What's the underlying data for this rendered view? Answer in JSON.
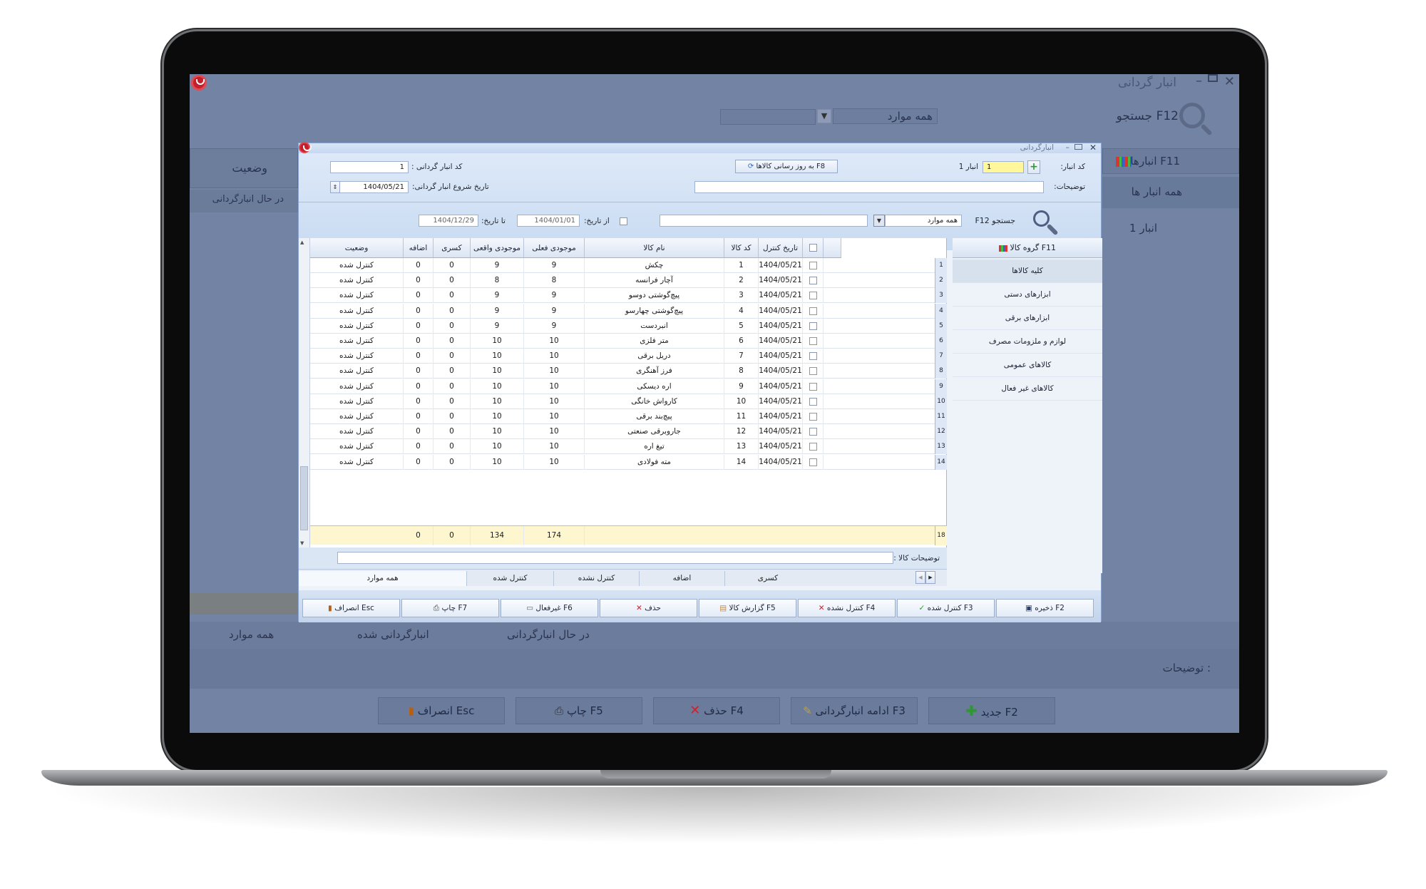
{
  "bg_window": {
    "title": "انبار گردانی",
    "minimize": "–",
    "close": "✕",
    "search_label": "جستجو F12",
    "search_scope": "همه موارد",
    "warehouses_header": "انبارها F11",
    "warehouses": [
      "همه انبار ها",
      "انبار 1"
    ],
    "status_header": "وضعیت",
    "status_value": "در حال انبارگردانی",
    "tabs": [
      "در حال انبارگردانی",
      "انبارگردانی شده",
      "همه موارد"
    ],
    "notes_label": "توضیحات :",
    "buttons": {
      "new": "جدید F2",
      "continue": "ادامه انبارگردانی F3",
      "delete": "حذف F4",
      "print": "چاپ F5",
      "cancel": "انصراف Esc"
    }
  },
  "dialog": {
    "title": "انبارگردانی",
    "warehouse_code_label": "کد انبار:",
    "warehouse_code_value": "1",
    "warehouse_name": "انبار 1",
    "notes_label": "توضیحات:",
    "update_button": "به روز رسانی کالاها F8",
    "count_code_label": "کد انبار گردانی :",
    "count_code_value": "1",
    "start_date_label": "تاریخ شروع انبار گردانی:",
    "start_date_value": "1404/05/21",
    "search_label": "جستجو F12",
    "search_scope": "همه موارد",
    "from_date_label": "از تاریخ:",
    "from_date_value": "1404/01/01",
    "to_date_label": "تا تاریخ:",
    "to_date_value": "1404/12/29",
    "columns": [
      "تاریخ کنترل",
      "کد کالا",
      "نام کالا",
      "موجودی فعلی",
      "موجودی واقعی",
      "کسری",
      "اضافه",
      "وضعیت"
    ],
    "rows": [
      {
        "idx": "1",
        "date": "1404/05/21",
        "code": "1",
        "name": "چکش",
        "current": "9",
        "actual": "9",
        "shortage": "0",
        "surplus": "0",
        "status": "کنترل شده"
      },
      {
        "idx": "2",
        "date": "1404/05/21",
        "code": "2",
        "name": "آچار فرانسه",
        "current": "8",
        "actual": "8",
        "shortage": "0",
        "surplus": "0",
        "status": "کنترل شده"
      },
      {
        "idx": "3",
        "date": "1404/05/21",
        "code": "3",
        "name": "پیچ‌گوشتی دوسو",
        "current": "9",
        "actual": "9",
        "shortage": "0",
        "surplus": "0",
        "status": "کنترل شده"
      },
      {
        "idx": "4",
        "date": "1404/05/21",
        "code": "4",
        "name": "پیچ‌گوشتی چهارسو",
        "current": "9",
        "actual": "9",
        "shortage": "0",
        "surplus": "0",
        "status": "کنترل شده"
      },
      {
        "idx": "5",
        "date": "1404/05/21",
        "code": "5",
        "name": "انبردست",
        "current": "9",
        "actual": "9",
        "shortage": "0",
        "surplus": "0",
        "status": "کنترل شده"
      },
      {
        "idx": "6",
        "date": "1404/05/21",
        "code": "6",
        "name": "متر فلزی",
        "current": "10",
        "actual": "10",
        "shortage": "0",
        "surplus": "0",
        "status": "کنترل شده"
      },
      {
        "idx": "7",
        "date": "1404/05/21",
        "code": "7",
        "name": "دریل برقی",
        "current": "10",
        "actual": "10",
        "shortage": "0",
        "surplus": "0",
        "status": "کنترل شده"
      },
      {
        "idx": "8",
        "date": "1404/05/21",
        "code": "8",
        "name": "فرز آهنگری",
        "current": "10",
        "actual": "10",
        "shortage": "0",
        "surplus": "0",
        "status": "کنترل شده"
      },
      {
        "idx": "9",
        "date": "1404/05/21",
        "code": "9",
        "name": "اره دیسکی",
        "current": "10",
        "actual": "10",
        "shortage": "0",
        "surplus": "0",
        "status": "کنترل شده"
      },
      {
        "idx": "10",
        "date": "1404/05/21",
        "code": "10",
        "name": "کارواش خانگی",
        "current": "10",
        "actual": "10",
        "shortage": "0",
        "surplus": "0",
        "status": "کنترل شده"
      },
      {
        "idx": "11",
        "date": "1404/05/21",
        "code": "11",
        "name": "پیچ‌بند برقی",
        "current": "10",
        "actual": "10",
        "shortage": "0",
        "surplus": "0",
        "status": "کنترل شده"
      },
      {
        "idx": "12",
        "date": "1404/05/21",
        "code": "12",
        "name": "جاروبرقی صنعتی",
        "current": "10",
        "actual": "10",
        "shortage": "0",
        "surplus": "0",
        "status": "کنترل شده"
      },
      {
        "idx": "13",
        "date": "1404/05/21",
        "code": "13",
        "name": "تیغ اره",
        "current": "10",
        "actual": "10",
        "shortage": "0",
        "surplus": "0",
        "status": "کنترل شده"
      },
      {
        "idx": "14",
        "date": "1404/05/21",
        "code": "14",
        "name": "مته فولادی",
        "current": "10",
        "actual": "10",
        "shortage": "0",
        "surplus": "0",
        "status": "کنترل شده"
      }
    ],
    "totals": {
      "count": "18",
      "current": "174",
      "actual": "134",
      "shortage": "0",
      "surplus": "0"
    },
    "item_notes_label": "توضیحات کالا :",
    "group_header": "گروه کالا F11",
    "groups": [
      "کلیه کالاها",
      "ابزارهای دستی",
      "ابزارهای برقی",
      "لوازم و ملزومات مصرف",
      "کالاهای عمومی",
      "کالاهای غیر فعال"
    ],
    "tabs": [
      "کسری",
      "اضافه",
      "کنترل نشده",
      "کنترل شده",
      "همه موارد"
    ],
    "buttons": {
      "save": "ذخیره F2",
      "checked": "کنترل شده F3",
      "unchecked": "کنترل نشده F4",
      "report": "گزارش کالا F5",
      "delete": "حذف",
      "inactive": "غیرفعال F6",
      "print": "چاپ F7",
      "cancel": "انصراف Esc"
    }
  },
  "colors": {
    "accent_red": "#c41f2a",
    "checked_green": "#2a9a2a",
    "total_row": "#fdf6cf"
  }
}
